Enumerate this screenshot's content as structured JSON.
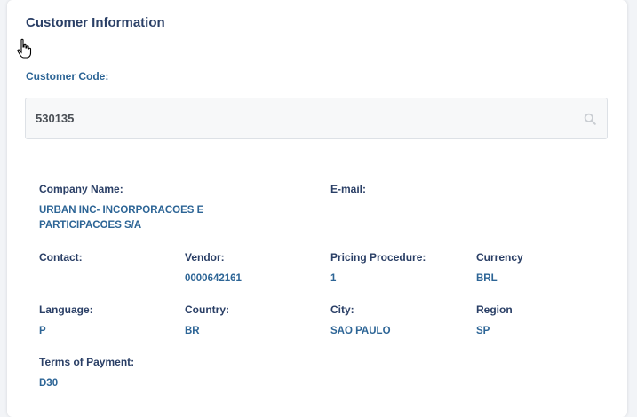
{
  "card": {
    "title": "Customer Information"
  },
  "customer_code": {
    "label": "Customer Code:",
    "value": "530135",
    "icon": "search-icon"
  },
  "details": {
    "company_name": {
      "label": "Company Name:",
      "value_line1": "URBAN INC- INCORPORACOES E",
      "value_line2": "PARTICIPACOES S/A"
    },
    "email": {
      "label": "E-mail:",
      "value": ""
    },
    "contact": {
      "label": "Contact:",
      "value": ""
    },
    "vendor": {
      "label": "Vendor:",
      "value": "0000642161"
    },
    "pricing_procedure": {
      "label": "Pricing Procedure:",
      "value": "1"
    },
    "currency": {
      "label": "Currency",
      "value": "BRL"
    },
    "language": {
      "label": "Language:",
      "value": "P"
    },
    "country": {
      "label": "Country:",
      "value": "BR"
    },
    "city": {
      "label": "City:",
      "value": "SAO PAULO"
    },
    "region": {
      "label": "Region",
      "value": "SP"
    },
    "terms_of_payment": {
      "label": "Terms of Payment:",
      "value": "D30"
    }
  },
  "colors": {
    "title": "#2a3f66",
    "label": "#2d6596",
    "value": "#2d6596"
  }
}
